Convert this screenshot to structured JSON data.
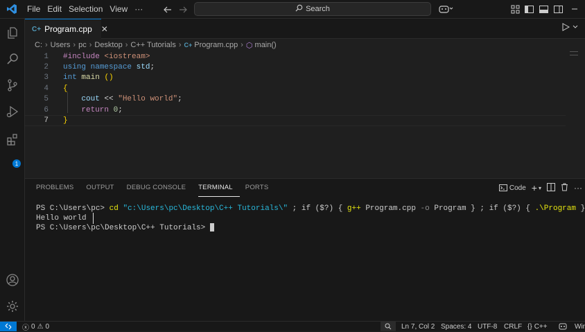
{
  "menu": [
    "File",
    "Edit",
    "Selection",
    "View",
    "···"
  ],
  "search": {
    "placeholder": "Search"
  },
  "tab": {
    "filename": "Program.cpp",
    "close": "✕"
  },
  "breadcrumbs": [
    "C:",
    "Users",
    "pc",
    "Desktop",
    "C++ Tutorials",
    "Program.cpp",
    "main()"
  ],
  "code_lines": [
    {
      "num": "1"
    },
    {
      "num": "2"
    },
    {
      "num": "3"
    },
    {
      "num": "4"
    },
    {
      "num": "5"
    },
    {
      "num": "6"
    },
    {
      "num": "7"
    }
  ],
  "code": {
    "l1a": "#include",
    "l1b": "<iostream>",
    "l2a": "using",
    "l2b": "namespace",
    "l2c": "std",
    "l3a": "int",
    "l3b": "main",
    "l4": "{",
    "l5a": "cout",
    "l5b": "<<",
    "l5c": "\"Hello world\"",
    "l6a": "return",
    "l6b": "0",
    "l7": "}"
  },
  "panel": {
    "tabs": [
      "PROBLEMS",
      "OUTPUT",
      "DEBUG CONSOLE",
      "TERMINAL",
      "PORTS"
    ],
    "active_tab": "TERMINAL",
    "shell_label": "Code"
  },
  "terminal": {
    "prompt1": "PS C:\\Users\\pc> ",
    "cmd_cd": "cd",
    "cmd_path": "\"c:\\Users\\pc\\Desktop\\C++ Tutorials\\\"",
    "cmd_rest1": " ; if ($?) { ",
    "cmd_gpp": "g++",
    "cmd_rest2": " Program.cpp ",
    "cmd_o": "-o",
    "cmd_rest3": " Program } ; if ($?) { ",
    "cmd_run": ".\\Program",
    "cmd_rest4": " }",
    "output": "Hello world",
    "prompt2": "PS C:\\Users\\pc\\Desktop\\C++ Tutorials> "
  },
  "status": {
    "errors": "0",
    "warnings": "0",
    "position": "Ln 7, Col 2",
    "spaces": "Spaces: 4",
    "encoding": "UTF-8",
    "eol": "CRLF",
    "language": "C++",
    "extra": "Wir"
  },
  "badge": "1",
  "colors": {
    "accent": "#0078d4",
    "background": "#1f1f1f",
    "chrome": "#181818"
  }
}
